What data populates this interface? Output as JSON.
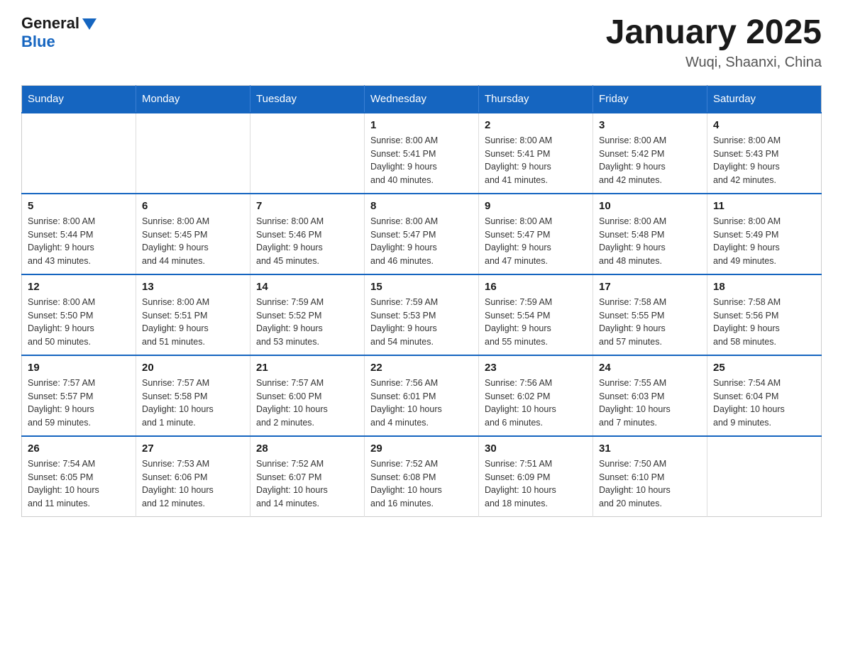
{
  "header": {
    "logo_general": "General",
    "logo_blue": "Blue",
    "month_title": "January 2025",
    "location": "Wuqi, Shaanxi, China"
  },
  "calendar": {
    "days_of_week": [
      "Sunday",
      "Monday",
      "Tuesday",
      "Wednesday",
      "Thursday",
      "Friday",
      "Saturday"
    ],
    "weeks": [
      [
        {
          "day": "",
          "info": ""
        },
        {
          "day": "",
          "info": ""
        },
        {
          "day": "",
          "info": ""
        },
        {
          "day": "1",
          "info": "Sunrise: 8:00 AM\nSunset: 5:41 PM\nDaylight: 9 hours\nand 40 minutes."
        },
        {
          "day": "2",
          "info": "Sunrise: 8:00 AM\nSunset: 5:41 PM\nDaylight: 9 hours\nand 41 minutes."
        },
        {
          "day": "3",
          "info": "Sunrise: 8:00 AM\nSunset: 5:42 PM\nDaylight: 9 hours\nand 42 minutes."
        },
        {
          "day": "4",
          "info": "Sunrise: 8:00 AM\nSunset: 5:43 PM\nDaylight: 9 hours\nand 42 minutes."
        }
      ],
      [
        {
          "day": "5",
          "info": "Sunrise: 8:00 AM\nSunset: 5:44 PM\nDaylight: 9 hours\nand 43 minutes."
        },
        {
          "day": "6",
          "info": "Sunrise: 8:00 AM\nSunset: 5:45 PM\nDaylight: 9 hours\nand 44 minutes."
        },
        {
          "day": "7",
          "info": "Sunrise: 8:00 AM\nSunset: 5:46 PM\nDaylight: 9 hours\nand 45 minutes."
        },
        {
          "day": "8",
          "info": "Sunrise: 8:00 AM\nSunset: 5:47 PM\nDaylight: 9 hours\nand 46 minutes."
        },
        {
          "day": "9",
          "info": "Sunrise: 8:00 AM\nSunset: 5:47 PM\nDaylight: 9 hours\nand 47 minutes."
        },
        {
          "day": "10",
          "info": "Sunrise: 8:00 AM\nSunset: 5:48 PM\nDaylight: 9 hours\nand 48 minutes."
        },
        {
          "day": "11",
          "info": "Sunrise: 8:00 AM\nSunset: 5:49 PM\nDaylight: 9 hours\nand 49 minutes."
        }
      ],
      [
        {
          "day": "12",
          "info": "Sunrise: 8:00 AM\nSunset: 5:50 PM\nDaylight: 9 hours\nand 50 minutes."
        },
        {
          "day": "13",
          "info": "Sunrise: 8:00 AM\nSunset: 5:51 PM\nDaylight: 9 hours\nand 51 minutes."
        },
        {
          "day": "14",
          "info": "Sunrise: 7:59 AM\nSunset: 5:52 PM\nDaylight: 9 hours\nand 53 minutes."
        },
        {
          "day": "15",
          "info": "Sunrise: 7:59 AM\nSunset: 5:53 PM\nDaylight: 9 hours\nand 54 minutes."
        },
        {
          "day": "16",
          "info": "Sunrise: 7:59 AM\nSunset: 5:54 PM\nDaylight: 9 hours\nand 55 minutes."
        },
        {
          "day": "17",
          "info": "Sunrise: 7:58 AM\nSunset: 5:55 PM\nDaylight: 9 hours\nand 57 minutes."
        },
        {
          "day": "18",
          "info": "Sunrise: 7:58 AM\nSunset: 5:56 PM\nDaylight: 9 hours\nand 58 minutes."
        }
      ],
      [
        {
          "day": "19",
          "info": "Sunrise: 7:57 AM\nSunset: 5:57 PM\nDaylight: 9 hours\nand 59 minutes."
        },
        {
          "day": "20",
          "info": "Sunrise: 7:57 AM\nSunset: 5:58 PM\nDaylight: 10 hours\nand 1 minute."
        },
        {
          "day": "21",
          "info": "Sunrise: 7:57 AM\nSunset: 6:00 PM\nDaylight: 10 hours\nand 2 minutes."
        },
        {
          "day": "22",
          "info": "Sunrise: 7:56 AM\nSunset: 6:01 PM\nDaylight: 10 hours\nand 4 minutes."
        },
        {
          "day": "23",
          "info": "Sunrise: 7:56 AM\nSunset: 6:02 PM\nDaylight: 10 hours\nand 6 minutes."
        },
        {
          "day": "24",
          "info": "Sunrise: 7:55 AM\nSunset: 6:03 PM\nDaylight: 10 hours\nand 7 minutes."
        },
        {
          "day": "25",
          "info": "Sunrise: 7:54 AM\nSunset: 6:04 PM\nDaylight: 10 hours\nand 9 minutes."
        }
      ],
      [
        {
          "day": "26",
          "info": "Sunrise: 7:54 AM\nSunset: 6:05 PM\nDaylight: 10 hours\nand 11 minutes."
        },
        {
          "day": "27",
          "info": "Sunrise: 7:53 AM\nSunset: 6:06 PM\nDaylight: 10 hours\nand 12 minutes."
        },
        {
          "day": "28",
          "info": "Sunrise: 7:52 AM\nSunset: 6:07 PM\nDaylight: 10 hours\nand 14 minutes."
        },
        {
          "day": "29",
          "info": "Sunrise: 7:52 AM\nSunset: 6:08 PM\nDaylight: 10 hours\nand 16 minutes."
        },
        {
          "day": "30",
          "info": "Sunrise: 7:51 AM\nSunset: 6:09 PM\nDaylight: 10 hours\nand 18 minutes."
        },
        {
          "day": "31",
          "info": "Sunrise: 7:50 AM\nSunset: 6:10 PM\nDaylight: 10 hours\nand 20 minutes."
        },
        {
          "day": "",
          "info": ""
        }
      ]
    ]
  }
}
